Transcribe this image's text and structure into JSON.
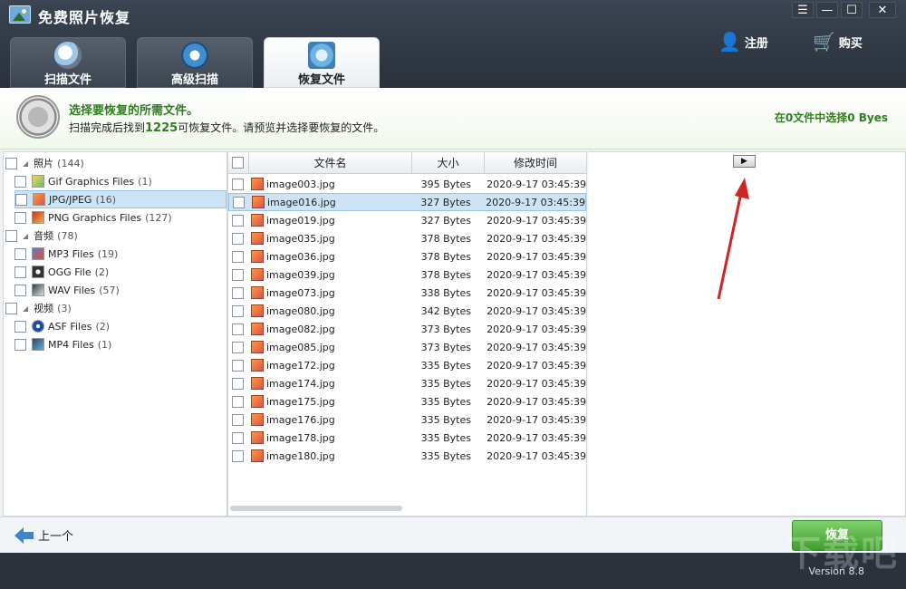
{
  "app": {
    "title": "免费照片恢复",
    "version": "Version 8.8",
    "watermark": "下载吧"
  },
  "window_controls": {
    "menu": "☰",
    "minimize": "—",
    "maximize": "☐",
    "close": "✕"
  },
  "header_actions": {
    "register": "注册",
    "buy": "购买"
  },
  "tabs": [
    {
      "label": "扫描文件",
      "icon": "magnifier-icon"
    },
    {
      "label": "高级扫描",
      "icon": "gear-icon"
    },
    {
      "label": "恢复文件",
      "icon": "recover-icon",
      "active": true
    }
  ],
  "banner": {
    "title": "选择要恢复的所需文件。",
    "desc_prefix": "扫描完成后找到",
    "found_count": "1225",
    "desc_suffix": "可恢复文件。请预览并选择要恢复的文件。",
    "selected_summary": "在0文件中选择0 Byes"
  },
  "tree": {
    "categories": [
      {
        "label": "照片",
        "count": "(144)",
        "children": [
          {
            "label": "Gif Graphics Files",
            "count": "(1)",
            "icon": "gif-icon"
          },
          {
            "label": "JPG/JPEG",
            "count": "(16)",
            "icon": "jpg-icon",
            "selected": true
          },
          {
            "label": "PNG Graphics Files",
            "count": "(127)",
            "icon": "png-icon"
          }
        ]
      },
      {
        "label": "音频",
        "count": "(78)",
        "children": [
          {
            "label": "MP3 Files",
            "count": "(19)",
            "icon": "mp3-icon"
          },
          {
            "label": "OGG File",
            "count": "(2)",
            "icon": "ogg-icon"
          },
          {
            "label": "WAV Files",
            "count": "(57)",
            "icon": "wav-icon"
          }
        ]
      },
      {
        "label": "视频",
        "count": "(3)",
        "children": [
          {
            "label": "ASF Files",
            "count": "(2)",
            "icon": "asf-icon"
          },
          {
            "label": "MP4 Files",
            "count": "(1)",
            "icon": "mp4-icon"
          }
        ]
      }
    ]
  },
  "filelist": {
    "columns": {
      "name": "文件名",
      "size": "大小",
      "time": "修改时间"
    },
    "rows": [
      {
        "name": "image003.jpg",
        "size": "395 Bytes",
        "time": "2020-9-17 03:45:39"
      },
      {
        "name": "image016.jpg",
        "size": "327 Bytes",
        "time": "2020-9-17 03:45:39",
        "selected": true
      },
      {
        "name": "image019.jpg",
        "size": "327 Bytes",
        "time": "2020-9-17 03:45:39"
      },
      {
        "name": "image035.jpg",
        "size": "378 Bytes",
        "time": "2020-9-17 03:45:39"
      },
      {
        "name": "image036.jpg",
        "size": "378 Bytes",
        "time": "2020-9-17 03:45:39"
      },
      {
        "name": "image039.jpg",
        "size": "378 Bytes",
        "time": "2020-9-17 03:45:39"
      },
      {
        "name": "image073.jpg",
        "size": "338 Bytes",
        "time": "2020-9-17 03:45:39"
      },
      {
        "name": "image080.jpg",
        "size": "342 Bytes",
        "time": "2020-9-17 03:45:39"
      },
      {
        "name": "image082.jpg",
        "size": "373 Bytes",
        "time": "2020-9-17 03:45:39"
      },
      {
        "name": "image085.jpg",
        "size": "373 Bytes",
        "time": "2020-9-17 03:45:39"
      },
      {
        "name": "image172.jpg",
        "size": "335 Bytes",
        "time": "2020-9-17 03:45:39"
      },
      {
        "name": "image174.jpg",
        "size": "335 Bytes",
        "time": "2020-9-17 03:45:39"
      },
      {
        "name": "image175.jpg",
        "size": "335 Bytes",
        "time": "2020-9-17 03:45:39"
      },
      {
        "name": "image176.jpg",
        "size": "335 Bytes",
        "time": "2020-9-17 03:45:39"
      },
      {
        "name": "image178.jpg",
        "size": "335 Bytes",
        "time": "2020-9-17 03:45:39"
      },
      {
        "name": "image180.jpg",
        "size": "335 Bytes",
        "time": "2020-9-17 03:45:39"
      }
    ]
  },
  "preview": {
    "play_symbol": "▶"
  },
  "bottom": {
    "back_label": "上一个",
    "recover_label": "恢复"
  },
  "colors": {
    "accent_green": "#2f7d1f",
    "header_bg": "#2b323c",
    "selection": "#cde4f7",
    "annotation_arrow": "#d22222"
  }
}
